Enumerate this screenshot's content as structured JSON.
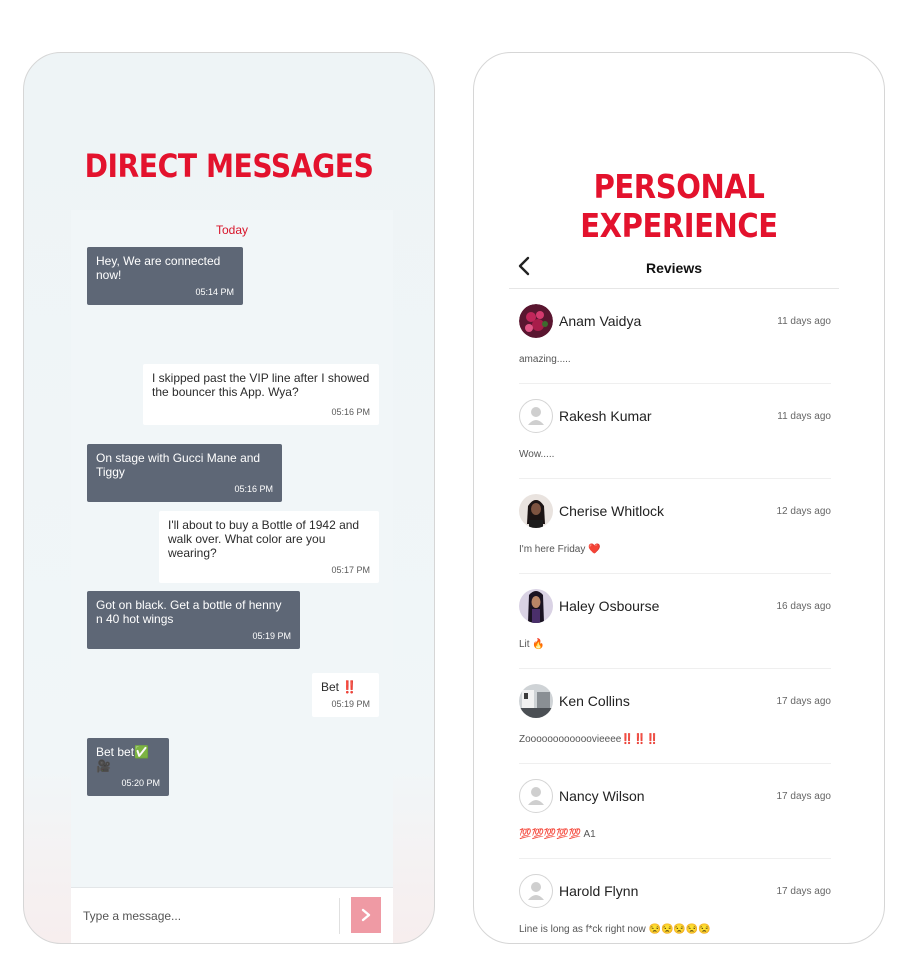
{
  "left_phone": {
    "headline": "DIRECT MESSAGES",
    "day_label": "Today",
    "messages": [
      {
        "direction": "incoming",
        "text": "Hey, We are connected now!",
        "time": "05:14 PM"
      },
      {
        "direction": "outgoing",
        "text": "I skipped past the VIP line after I showed the bouncer this App. Wya?",
        "time": "05:16 PM"
      },
      {
        "direction": "incoming",
        "text": "On stage with Gucci Mane and Tiggy",
        "time": "05:16 PM"
      },
      {
        "direction": "outgoing",
        "text": "I'll about to buy a Bottle of 1942 and walk over. What color are you wearing?",
        "time": "05:17 PM"
      },
      {
        "direction": "incoming",
        "text": "Got on black. Get a bottle of henny n 40 hot wings",
        "time": "05:19 PM"
      },
      {
        "direction": "outgoing",
        "text": "Bet ‼️",
        "time": "05:19 PM"
      },
      {
        "direction": "incoming",
        "text": "Bet bet✅🎥",
        "time": "05:20 PM"
      }
    ],
    "composer": {
      "placeholder": "Type a message...",
      "send_icon": "send-arrow-icon"
    },
    "colors": {
      "accent": "#e3122d",
      "incoming_bubble": "#5e6776",
      "send_button": "#ef9aa4"
    }
  },
  "right_phone": {
    "headline": "PERSONAL EXPERIENCE",
    "header": {
      "title": "Reviews",
      "back_icon": "chevron-left-icon"
    },
    "reviews": [
      {
        "name": "Anam Vaidya",
        "time": "11 days ago",
        "text": "amazing.....",
        "avatar": "photo"
      },
      {
        "name": "Rakesh Kumar",
        "time": "11 days ago",
        "text": "Wow.....",
        "avatar": "placeholder"
      },
      {
        "name": "Cherise Whitlock",
        "time": "12 days ago",
        "text": "I'm here Friday ❤️",
        "avatar": "photo"
      },
      {
        "name": "Haley Osbourse",
        "time": "16 days ago",
        "text": "Lit 🔥",
        "avatar": "photo"
      },
      {
        "name": "Ken Collins",
        "time": "17 days ago",
        "text": "Zoooooooooooovieeee‼️‼️‼️",
        "avatar": "photo"
      },
      {
        "name": "Nancy Wilson",
        "time": "17 days ago",
        "text": "💯💯💯💯💯 A1",
        "avatar": "placeholder"
      },
      {
        "name": "Harold Flynn",
        "time": "17 days ago",
        "text": "Line is long as f*ck right now 😒😒😒😒😒",
        "avatar": "placeholder"
      }
    ]
  }
}
